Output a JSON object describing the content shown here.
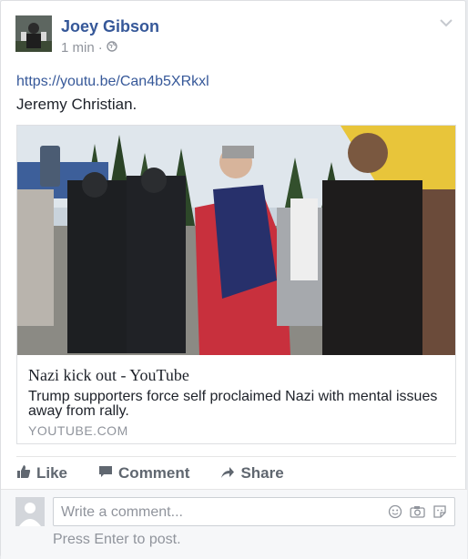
{
  "post": {
    "author": "Joey Gibson",
    "time": "1 min",
    "dot": "·",
    "link": "https://youtu.be/Can4b5XRkxl",
    "text": "Jeremy Christian.",
    "icons": {
      "privacy": "globe-icon",
      "menu": "chevron-down-icon"
    }
  },
  "preview": {
    "title": "Nazi kick out - YouTube",
    "description": "Trump supporters force self proclaimed Nazi with mental issues away from rally.",
    "domain": "YOUTUBE.COM"
  },
  "actions": {
    "like": "Like",
    "comment": "Comment",
    "share": "Share"
  },
  "composer": {
    "placeholder": "Write a comment...",
    "hint": "Press Enter to post.",
    "icons": [
      "smiley-icon",
      "camera-icon",
      "sticker-icon"
    ]
  },
  "colors": {
    "link": "#365899",
    "muted": "#90949c",
    "text": "#1d2129"
  }
}
